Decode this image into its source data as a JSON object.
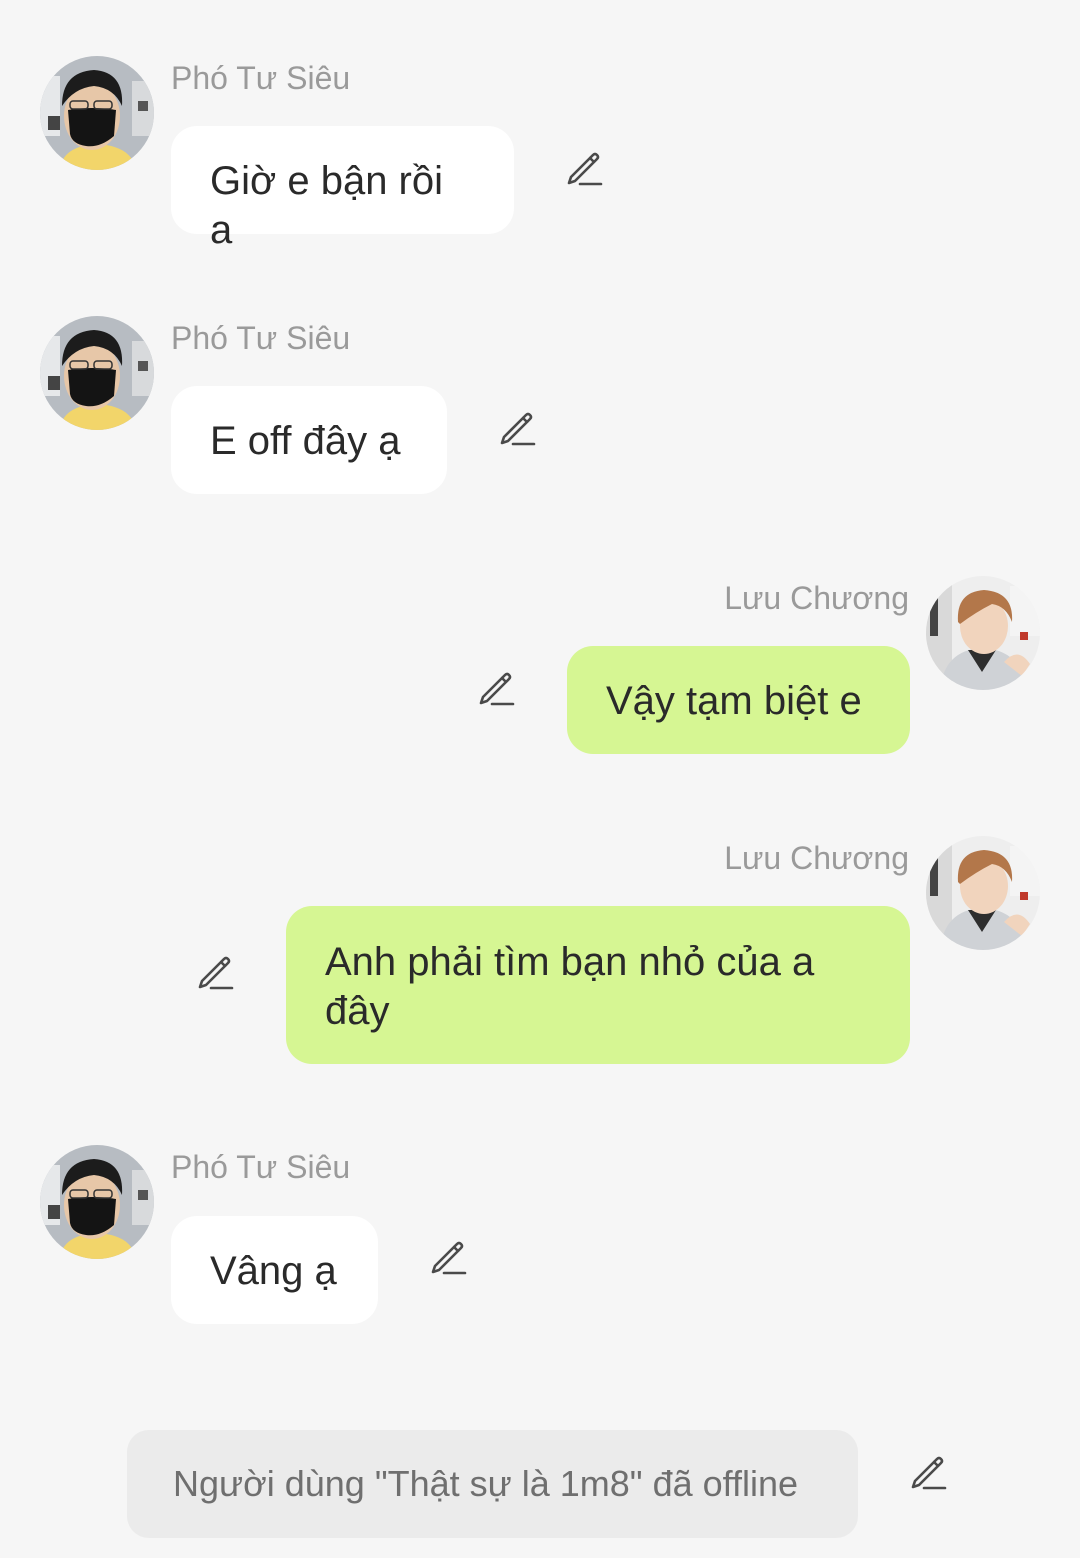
{
  "users": {
    "a": {
      "name": "Phó Tư Siêu"
    },
    "b": {
      "name": "Lưu Chương"
    }
  },
  "messages": [
    {
      "sender": "Phó Tư Siêu",
      "text": "Giờ e bận rồi a"
    },
    {
      "sender": "Phó Tư Siêu",
      "text": "E off đây ạ"
    },
    {
      "sender": "Lưu Chương",
      "text": "Vậy tạm biệt e"
    },
    {
      "sender": "Lưu Chương",
      "text": "Anh phải tìm bạn nhỏ của a đây"
    },
    {
      "sender": "Phó Tư Siêu",
      "text": "Vâng ạ"
    }
  ],
  "system_message": {
    "text": "Người dùng \"Thật sự là 1m8\" đã offline"
  },
  "colors": {
    "background": "#f6f6f6",
    "incoming_bubble": "#ffffff",
    "outgoing_bubble": "#d6f693",
    "name_text": "#9a9a9a",
    "system_bubble": "#ebebeb"
  },
  "icons": {
    "edit": "pencil-icon",
    "avatar_a": "masked-person-avatar",
    "avatar_b": "light-haired-person-avatar"
  }
}
